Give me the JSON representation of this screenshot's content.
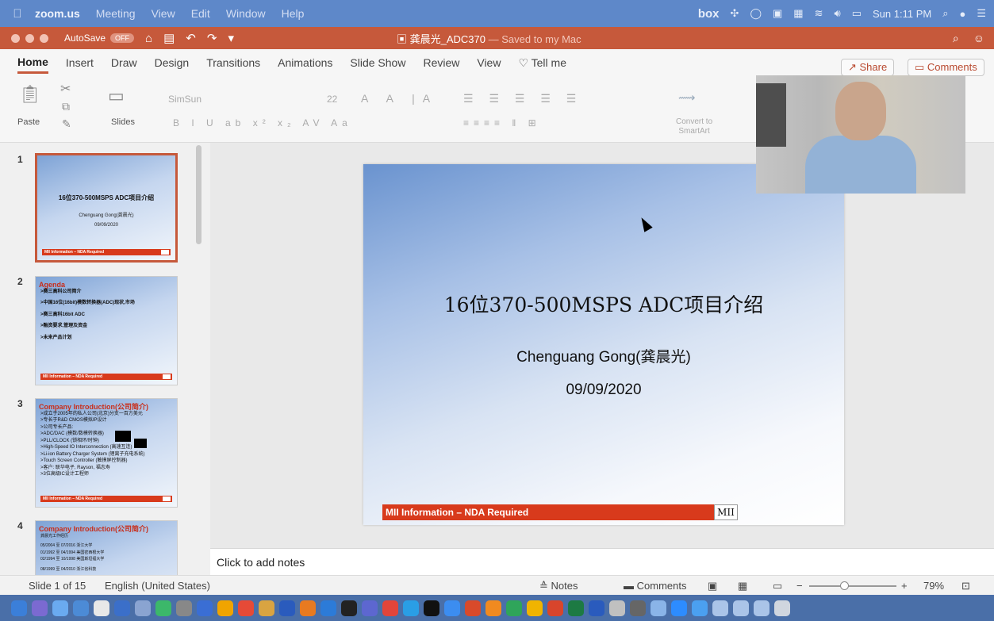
{
  "menubar": {
    "items": [
      "zoom.us",
      "Meeting",
      "View",
      "Edit",
      "Window",
      "Help"
    ],
    "box": "box",
    "clock": "Sun 1:11 PM"
  },
  "titlebar": {
    "autosave": "AutoSave",
    "autosave_state": "OFF",
    "doc_name": "龚晨光_ADC370",
    "saved": "— Saved to my Mac"
  },
  "ribbon": {
    "tabs": [
      "Home",
      "Insert",
      "Draw",
      "Design",
      "Transitions",
      "Animations",
      "Slide Show",
      "Review",
      "View",
      "Tell me"
    ],
    "share": "Share",
    "comments": "Comments",
    "paste": "Paste",
    "slides": "Slides",
    "font_name": "SimSun",
    "font_size": "22",
    "convert": "Convert to",
    "smartart": "SmartArt"
  },
  "thumbnails": [
    {
      "num": "1",
      "title": "16位370-500MSPS ADC项目介绍",
      "line1": "Chenguang Gong(龚晨光)",
      "line2": "09/09/2020",
      "footer": "MII Information – NDA Required"
    },
    {
      "num": "2",
      "title": "Agenda",
      "lines": [
        ">赛三高科公司简介",
        ">中国16位(16bit)模数转换器(ADC)现状,市场",
        ">赛三高科16bit ADC",
        ">融资要求,管理及资金",
        ">未来产品计划"
      ],
      "footer": "MII Information – NDA Required"
    },
    {
      "num": "3",
      "title": "Company Introduction(公司简介)",
      "lines": [
        ">成立于2005年的私人公司(北京)分支一百方美元",
        ">专长于R&D CMOS模拟IP设计",
        ">公司专长产品:",
        "  >ADC/DAC (模数/数模转换器)",
        "  >PLL/CLOCK (锁相环/时钟)",
        "  >High-Speed IO Interconnection (高速互连)",
        "  >Li-ion Battery Charger System (锂离子充电系统)",
        "  >Touch Screen Controller (触摸屏控制器)",
        ">客户: 联华电子, Rayson, 福志寿",
        ">3位高级IC设计工程师"
      ],
      "footer": "MII Information – NDA Required"
    },
    {
      "num": "4",
      "title": "Company Introduction(公司简介)",
      "lines": [
        "龚晨光工作经历",
        "05/2004 至 07/2016  浙江大学",
        "01/1992 至 04/1994  美国密西根大学",
        "02/1994 至 10/1998  美国斯坦福大学",
        "08/1999 至 04/2010  浙江省科技"
      ]
    }
  ],
  "slide": {
    "title": "16位370-500MSPS ADC项目介绍",
    "author": "Chenguang Gong(龚晨光)",
    "date": "09/09/2020",
    "footer": "MII Information – NDA Required",
    "logo": "MII"
  },
  "notes_placeholder": "Click to add notes",
  "status": {
    "slide_count": "Slide 1 of 15",
    "language": "English (United States)",
    "notes": "Notes",
    "comments": "Comments",
    "zoom": "79%",
    "zoom_fraction": 0.4
  },
  "colors": {
    "ppt_accent": "#c6593b",
    "menubar": "#5e88c9",
    "footer_red": "#d83a1c"
  }
}
